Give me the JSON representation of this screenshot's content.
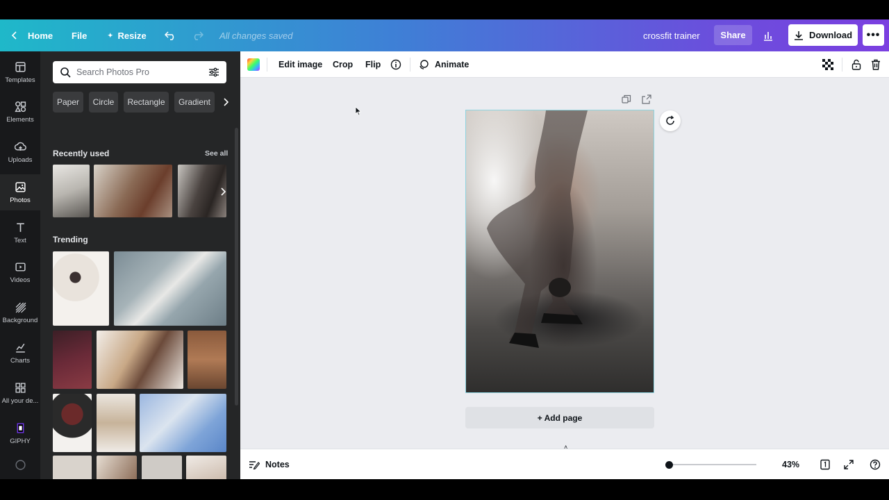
{
  "topbar": {
    "home": "Home",
    "file": "File",
    "resize": "Resize",
    "save_status": "All changes saved",
    "doc_title": "crossfit trainer",
    "share": "Share",
    "download": "Download"
  },
  "rail": [
    {
      "label": "Templates",
      "icon": "templates-icon"
    },
    {
      "label": "Elements",
      "icon": "elements-icon"
    },
    {
      "label": "Uploads",
      "icon": "uploads-icon"
    },
    {
      "label": "Photos",
      "icon": "photos-icon"
    },
    {
      "label": "Text",
      "icon": "text-icon"
    },
    {
      "label": "Videos",
      "icon": "videos-icon"
    },
    {
      "label": "Background",
      "icon": "background-icon"
    },
    {
      "label": "Charts",
      "icon": "charts-icon"
    },
    {
      "label": "All your de...",
      "icon": "apps-icon"
    },
    {
      "label": "GIPHY",
      "icon": "giphy-icon"
    }
  ],
  "panel": {
    "search_placeholder": "Search Photos Pro",
    "chips": [
      "Paper",
      "Circle",
      "Rectangle",
      "Gradient"
    ],
    "recent_title": "Recently used",
    "see_all": "See all",
    "trending_title": "Trending"
  },
  "toolbar": {
    "edit_image": "Edit image",
    "crop": "Crop",
    "flip": "Flip",
    "animate": "Animate"
  },
  "canvas": {
    "add_page": "+ Add page"
  },
  "bottom": {
    "notes": "Notes",
    "zoom": "43%",
    "zoom_level": 0.43
  },
  "colors": {
    "accent": "#7b3fe0",
    "selection": "#8ed4e0"
  }
}
